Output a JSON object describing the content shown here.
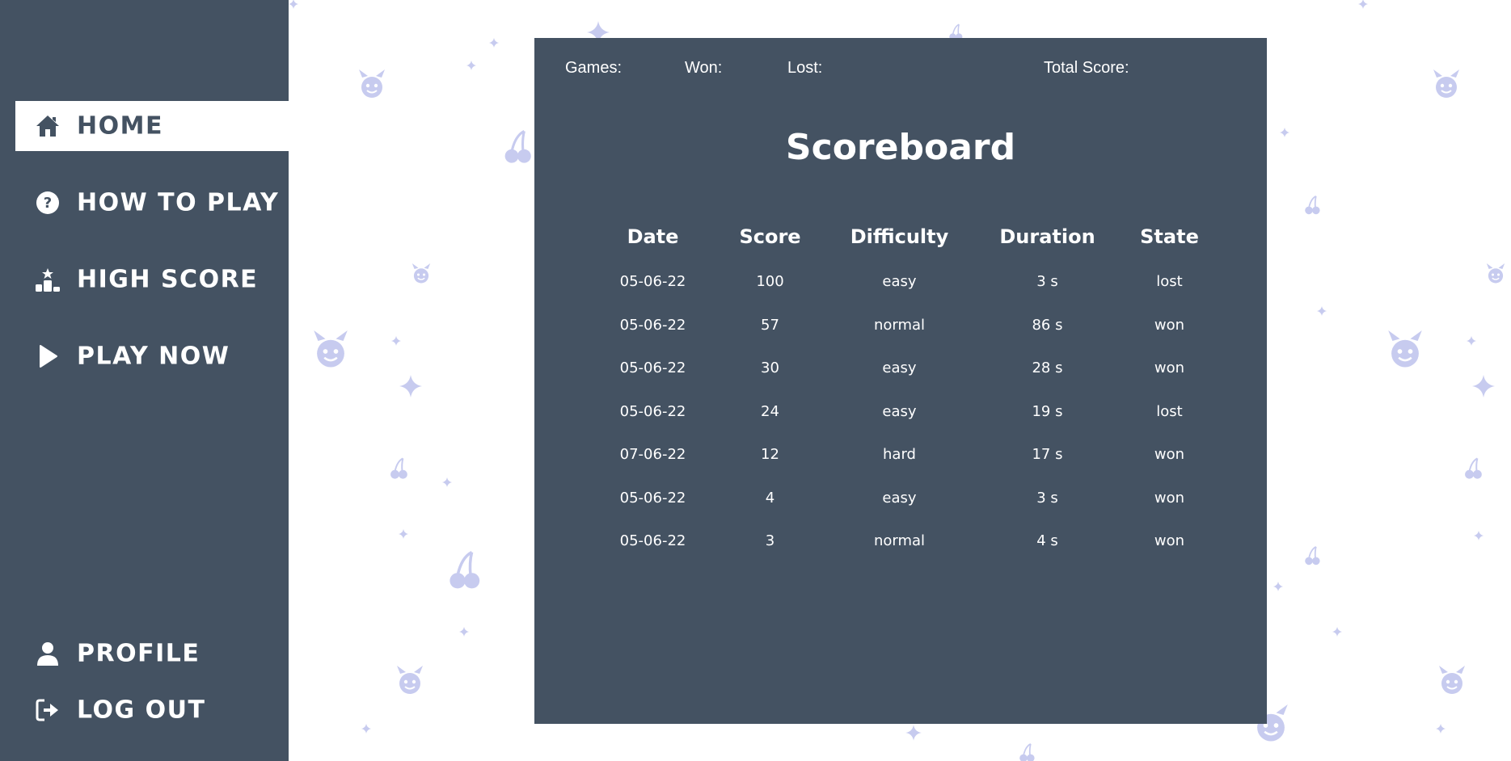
{
  "colors": {
    "sidebar": "#445262",
    "panel": "#445262",
    "text_on_dark": "#ffffff",
    "active_item_bg": "#ffffff",
    "background_pattern": "#c7cbef"
  },
  "sidebar": {
    "items": [
      {
        "label": "HOME",
        "icon": "home-icon",
        "active": true
      },
      {
        "label": "HOW TO PLAY",
        "icon": "question-circle-icon",
        "active": false
      },
      {
        "label": "HIGH SCORE",
        "icon": "podium-star-icon",
        "active": false
      },
      {
        "label": "PLAY NOW",
        "icon": "play-icon",
        "active": false
      }
    ],
    "bottom_items": [
      {
        "label": "PROFILE",
        "icon": "user-icon"
      },
      {
        "label": "LOG OUT",
        "icon": "logout-icon"
      }
    ]
  },
  "stats": {
    "games_label": "Games:",
    "won_label": "Won:",
    "lost_label": "Lost:",
    "total_score_label": "Total Score:"
  },
  "scoreboard": {
    "title": "Scoreboard",
    "columns": [
      "Date",
      "Score",
      "Difficulty",
      "Duration",
      "State"
    ],
    "rows": [
      [
        "05-06-22",
        "100",
        "easy",
        "3 s",
        "lost"
      ],
      [
        "05-06-22",
        "57",
        "normal",
        "86 s",
        "won"
      ],
      [
        "05-06-22",
        "30",
        "easy",
        "28 s",
        "won"
      ],
      [
        "05-06-22",
        "24",
        "easy",
        "19 s",
        "lost"
      ],
      [
        "07-06-22",
        "12",
        "hard",
        "17 s",
        "won"
      ],
      [
        "05-06-22",
        "4",
        "easy",
        "3 s",
        "won"
      ],
      [
        "05-06-22",
        "3",
        "normal",
        "4 s",
        "won"
      ]
    ]
  }
}
